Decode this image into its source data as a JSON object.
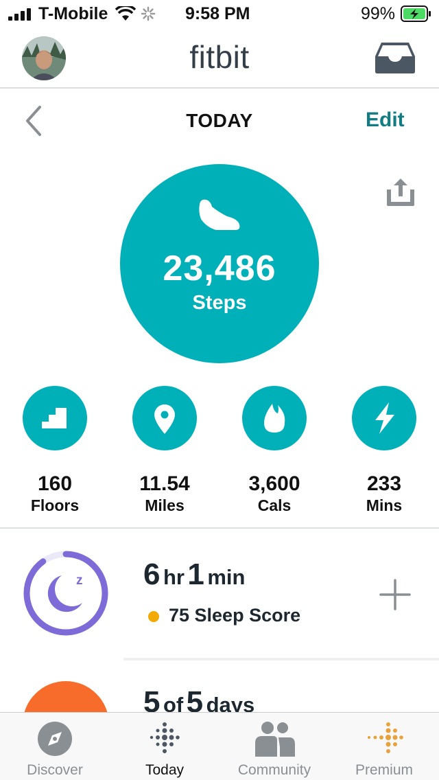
{
  "status_bar": {
    "carrier": "T-Mobile",
    "time": "9:58 PM",
    "battery": "99%"
  },
  "header": {
    "logo": "fitbit"
  },
  "date_nav": {
    "title": "TODAY",
    "edit_label": "Edit"
  },
  "steps": {
    "value": "23,486",
    "label": "Steps"
  },
  "stats": [
    {
      "value": "160",
      "label": "Floors",
      "icon": "stairs-icon"
    },
    {
      "value": "11.54",
      "label": "Miles",
      "icon": "location-pin-icon"
    },
    {
      "value": "3,600",
      "label": "Cals",
      "icon": "flame-icon"
    },
    {
      "value": "233",
      "label": "Mins",
      "icon": "lightning-icon"
    }
  ],
  "sleep": {
    "hours": "6",
    "hours_unit": "hr",
    "minutes": "1",
    "minutes_unit": "min",
    "score_text": "75 Sleep Score",
    "ring_progress": 0.9
  },
  "exercise": {
    "count": "5",
    "of": "of",
    "total": "5",
    "unit": "days"
  },
  "tabs": [
    {
      "label": "Discover",
      "icon": "compass-icon",
      "active": false
    },
    {
      "label": "Today",
      "icon": "fitbit-dots-icon",
      "active": true
    },
    {
      "label": "Community",
      "icon": "community-icon",
      "active": false
    },
    {
      "label": "Premium",
      "icon": "premium-dots-icon",
      "active": false
    }
  ],
  "colors": {
    "teal": "#00b0b9",
    "edit_teal": "#117d83",
    "sleep_purple": "#7f6bd8",
    "score_orange": "#f2a900",
    "exercise_orange": "#f76c2b"
  }
}
